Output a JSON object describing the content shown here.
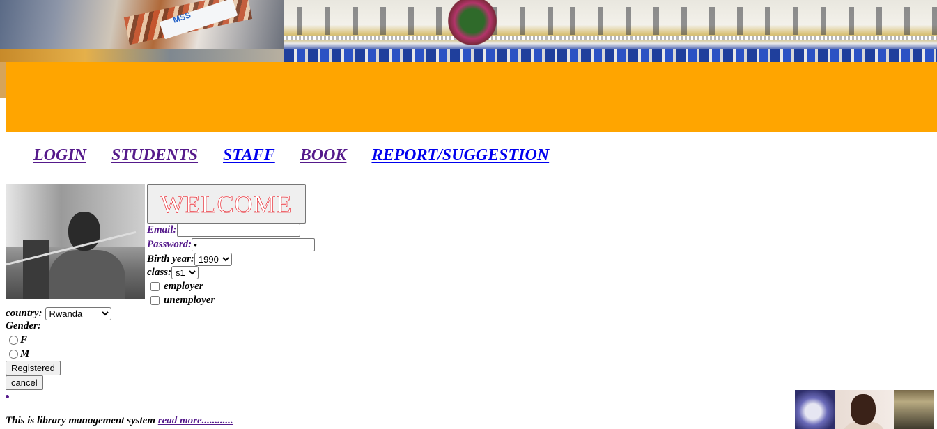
{
  "banner": {
    "left_photo_text": "MSS"
  },
  "nav": [
    {
      "label": "LOGIN ",
      "state": "visited"
    },
    {
      "label": "STUDENTS ",
      "state": "visited"
    },
    {
      "label": "STAFF ",
      "state": "unvisited"
    },
    {
      "label": "BOOK ",
      "state": "visited"
    },
    {
      "label": "REPORT/SUGGESTION",
      "state": "unvisited"
    }
  ],
  "form": {
    "welcome_label": "WELCOME",
    "email_label": "Email:",
    "email_value": "",
    "password_label": "Password:",
    "password_value": "•",
    "birth_year_label": "Birth year:",
    "birth_year_value": "1990",
    "class_label": "class:",
    "class_value": "s1",
    "employer_label": "employer",
    "unemployer_label": "unemployer",
    "country_label": "country:",
    "country_value": "Rwanda",
    "gender_label": "Gender:",
    "gender_f": "F",
    "gender_m": "M",
    "register_button": "Registered",
    "cancel_button": "cancel"
  },
  "footer": {
    "text": "This is library management system ",
    "link": "read more............"
  },
  "colors": {
    "orange_band": "#ffa500",
    "welcome_text": "#e8101a",
    "visited_link": "#551a8b",
    "unvisited_link": "#0000ee"
  }
}
